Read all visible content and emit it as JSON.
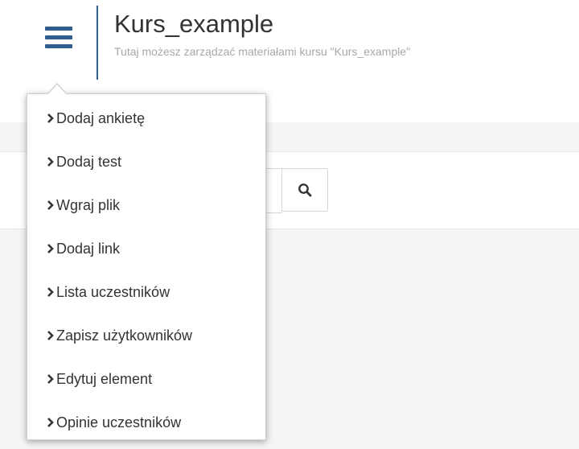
{
  "header": {
    "title": "Kurs_example",
    "subtitle": "Tutaj możesz zarządzać materiałami kursu \"Kurs_example\""
  },
  "icons": {
    "menu": "hamburger-menu-icon",
    "search": "search-icon",
    "item": "chevron-right-icon"
  },
  "colors": {
    "accent": "#2f5d8c",
    "text": "#333333",
    "muted": "#a8a8a8",
    "background": "#f5f5f5"
  },
  "menu": {
    "items": [
      {
        "label": "Dodaj ankietę"
      },
      {
        "label": "Dodaj test"
      },
      {
        "label": "Wgraj plik"
      },
      {
        "label": "Dodaj link"
      },
      {
        "label": "Lista uczestników"
      },
      {
        "label": "Zapisz użytkowników"
      },
      {
        "label": "Edytuj element"
      },
      {
        "label": "Opinie uczestników"
      }
    ]
  }
}
